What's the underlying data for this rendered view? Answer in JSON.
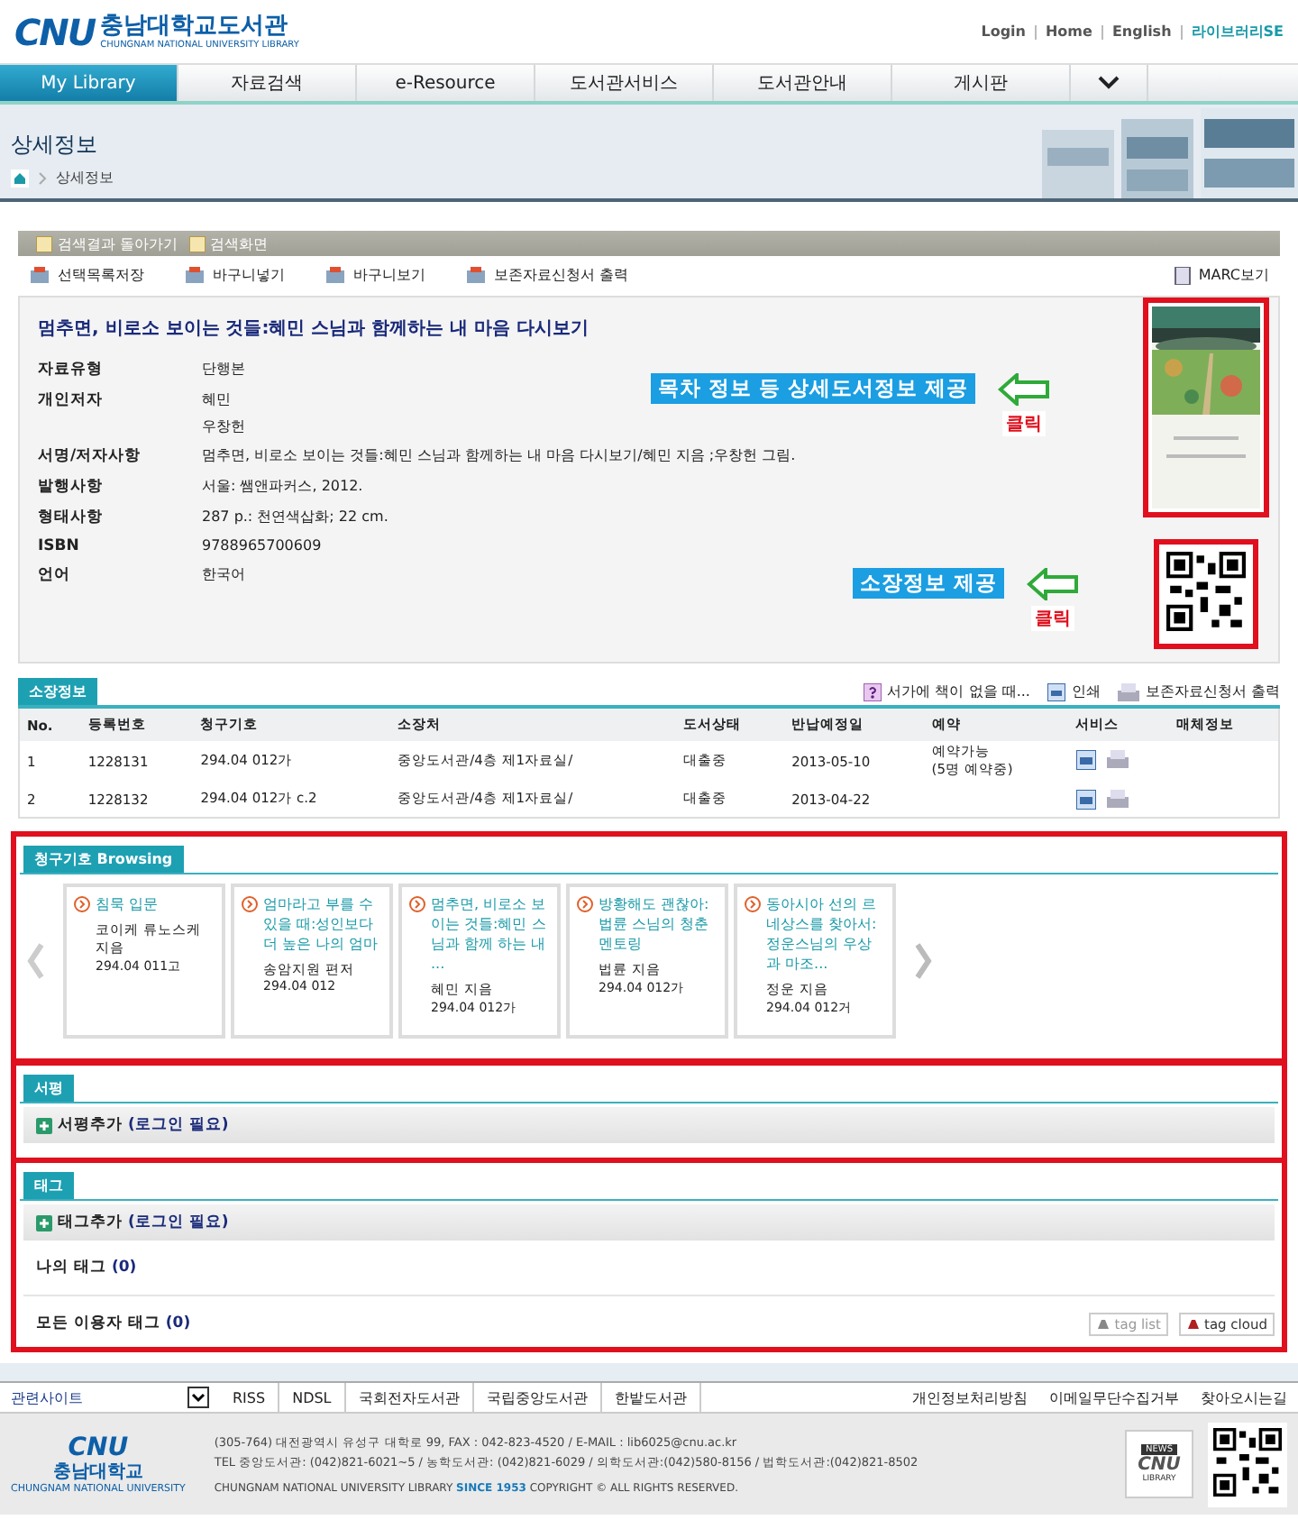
{
  "header": {
    "logo_mark": "CNU",
    "logo_name": "충남대학교도서관",
    "logo_subtitle": "CHUNGNAM NATIONAL UNIVERSITY LIBRARY",
    "links": [
      {
        "label": "Login",
        "kind": "plain"
      },
      {
        "label": "Home",
        "kind": "plain"
      },
      {
        "label": "English",
        "kind": "plain"
      },
      {
        "label": "라이브러리SE",
        "kind": "brand"
      }
    ]
  },
  "nav": [
    {
      "label": "My Library",
      "selected": true
    },
    {
      "label": "자료검색",
      "selected": false
    },
    {
      "label": "e-Resource",
      "selected": false
    },
    {
      "label": "도서관서비스",
      "selected": false
    },
    {
      "label": "도서관안내",
      "selected": false
    },
    {
      "label": "게시판",
      "selected": false
    }
  ],
  "banner": {
    "title": "상세정보",
    "breadcrumb": "상세정보"
  },
  "back_bar": [
    "검색결과 돌아가기",
    "검색화면"
  ],
  "toolbar": {
    "actions": [
      "선택목록저장",
      "바구니넣기",
      "바구니보기",
      "보존자료신청서 출력"
    ],
    "marc": "MARC보기"
  },
  "record": {
    "title": "멈추면, 비로소 보이는 것들:혜민 스님과 함께하는 내 마음 다시보기",
    "fields": [
      {
        "label": "자료유형",
        "values": [
          "단행본"
        ]
      },
      {
        "label": "개인저자",
        "values": [
          "혜민",
          "우창헌"
        ]
      },
      {
        "label": "서명/저자사항",
        "values": [
          "멈추면, 비로소 보이는 것들:혜민 스님과 함께하는 내 마음 다시보기/혜민 지음 ;우창헌 그림."
        ]
      },
      {
        "label": "발행사항",
        "values": [
          "서울: 쌤앤파커스, 2012."
        ]
      },
      {
        "label": "형태사항",
        "values": [
          "287 p.: 천연색삽화; 22 cm."
        ]
      },
      {
        "label": "ISBN",
        "values": [
          "9788965700609"
        ]
      },
      {
        "label": "언어",
        "values": [
          "한국어"
        ]
      }
    ],
    "cover_highlighted": true,
    "qr_highlighted": true,
    "callouts": [
      {
        "text": "목차 정보 등 상세도서정보 제공",
        "click": "클릭"
      },
      {
        "text": "소장정보 제공",
        "click": "클릭"
      }
    ]
  },
  "holdings": {
    "tab": "소장정보",
    "links": [
      {
        "label": "서가에 책이 없을 때...",
        "kind": "help"
      },
      {
        "label": "인쇄",
        "kind": "print"
      },
      {
        "label": "보존자료신청서 출력",
        "kind": "form"
      }
    ],
    "columns": [
      "No.",
      "등록번호",
      "청구기호",
      "소장처",
      "도서상태",
      "반납예정일",
      "예약",
      "서비스",
      "매체정보"
    ],
    "rows": [
      {
        "cells": [
          "1",
          "1228131",
          "294.04 012가",
          "중앙도서관/4층 제1자료실/",
          "대출중",
          "2013-05-10"
        ],
        "reservation": [
          "예약가능",
          "(5명 예약중)"
        ]
      },
      {
        "cells": [
          "2",
          "1228132",
          "294.04 012가 c.2",
          "중앙도서관/4층 제1자료실/",
          "대출중",
          "2013-04-22"
        ],
        "reservation": []
      }
    ]
  },
  "browsing": {
    "title": "청구기호 Browsing",
    "highlighted": true,
    "items": [
      {
        "title": "침묵 입문",
        "author": "코이케 류노스케 지음",
        "call_no": "294.04 011고"
      },
      {
        "title": "엄마라고 부를 수 있을 때:성인보다 더 높은 나의 엄마",
        "author": "송암지원 편저",
        "call_no": "294.04 012"
      },
      {
        "title": "멈추면, 비로소 보이는 것들:혜민 스님과 함께 하는 내 ...",
        "author": "혜민 지음",
        "call_no": "294.04 012가"
      },
      {
        "title": "방황해도 괜찮아:법륜 스님의 청춘 멘토링",
        "author": "법륜 지음",
        "call_no": "294.04 012가"
      },
      {
        "title": "동아시아 선의 르네상스를 찾아서:정운스님의 우상과 마조...",
        "author": "정운 지음",
        "call_no": "294.04 012거"
      }
    ]
  },
  "review": {
    "title": "서평",
    "highlighted": true,
    "add": "서평추가",
    "login": "(로그인 필요)"
  },
  "tags": {
    "title": "태그",
    "highlighted": true,
    "add": "태그추가",
    "login": "(로그인 필요)",
    "mine": {
      "label": "나의 태그",
      "count": "(0)"
    },
    "all": {
      "label": "모든 이용자 태그",
      "count": "(0)"
    },
    "buttons": [
      {
        "label": "tag list",
        "kind": "list"
      },
      {
        "label": "tag cloud",
        "kind": "cloud"
      }
    ]
  },
  "footer": {
    "related": "관련사이트",
    "sites": [
      "RISS",
      "NDSL",
      "국회전자도서관",
      "국립중앙도서관",
      "한밭도서관"
    ],
    "links": [
      "개인정보처리방침",
      "이메일무단수집거부",
      "찾아오시는길"
    ],
    "logo_mark": "CNU",
    "logo_name": "충남대학교",
    "logo_subtitle": "CHUNGNAM NATIONAL UNIVERSITY",
    "address": "(305-764) 대전광역시 유성구 대학로 99, FAX : 042-823-4520 / E-MAIL : lib6025@cnu.ac.kr",
    "tel": "TEL 중앙도서관: (042)821-6021~5 / 농학도서관: (042)821-6029 / 의학도서관:(042)580-8156 / 법학도서관:(042)821-8502",
    "copyright": "CHUNGNAM NATIONAL UNIVERSITY LIBRARY **SINCE 1953** COPYRIGHT © ALL RIGHTS RESERVED.",
    "news": {
      "top": "NEWS",
      "mark": "CNU",
      "bottom": "LIBRARY"
    }
  }
}
